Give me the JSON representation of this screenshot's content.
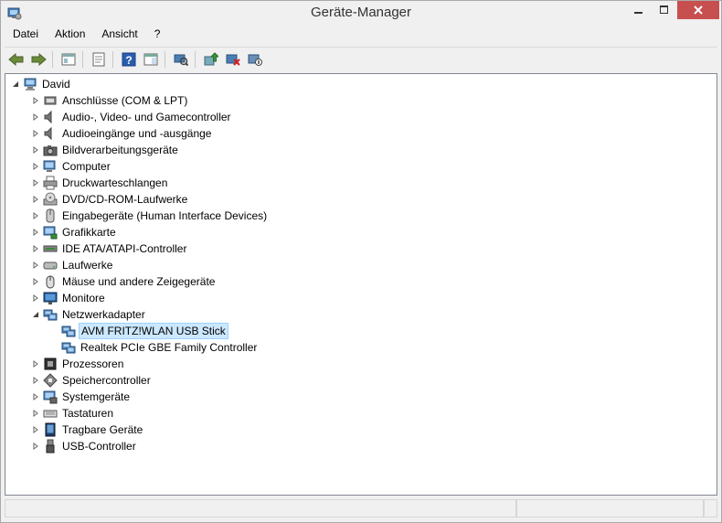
{
  "window": {
    "title": "Geräte-Manager"
  },
  "menu": {
    "items": [
      "Datei",
      "Aktion",
      "Ansicht",
      "?"
    ]
  },
  "tree": {
    "root": "David",
    "categories": [
      {
        "label": "Anschlüsse (COM & LPT)",
        "icon": "port-icon"
      },
      {
        "label": "Audio-, Video- und Gamecontroller",
        "icon": "speaker-icon"
      },
      {
        "label": "Audioeingänge und -ausgänge",
        "icon": "speaker-icon"
      },
      {
        "label": "Bildverarbeitungsgeräte",
        "icon": "camera-icon"
      },
      {
        "label": "Computer",
        "icon": "computer-icon"
      },
      {
        "label": "Druckwarteschlangen",
        "icon": "printer-icon"
      },
      {
        "label": "DVD/CD-ROM-Laufwerke",
        "icon": "disc-drive-icon"
      },
      {
        "label": "Eingabegeräte (Human Interface Devices)",
        "icon": "hid-icon"
      },
      {
        "label": "Grafikkarte",
        "icon": "display-adapter-icon"
      },
      {
        "label": "IDE ATA/ATAPI-Controller",
        "icon": "ide-controller-icon"
      },
      {
        "label": "Laufwerke",
        "icon": "disk-drive-icon"
      },
      {
        "label": "Mäuse und andere Zeigegeräte",
        "icon": "mouse-icon"
      },
      {
        "label": "Monitore",
        "icon": "monitor-icon"
      },
      {
        "label": "Netzwerkadapter",
        "icon": "network-adapter-icon",
        "expanded": true,
        "children": [
          {
            "label": "AVM FRITZ!WLAN USB Stick",
            "icon": "network-adapter-icon",
            "selected": true
          },
          {
            "label": "Realtek PCIe GBE Family Controller",
            "icon": "network-adapter-icon"
          }
        ]
      },
      {
        "label": "Prozessoren",
        "icon": "processor-icon"
      },
      {
        "label": "Speichercontroller",
        "icon": "storage-controller-icon"
      },
      {
        "label": "Systemgeräte",
        "icon": "system-device-icon"
      },
      {
        "label": "Tastaturen",
        "icon": "keyboard-icon"
      },
      {
        "label": "Tragbare Geräte",
        "icon": "portable-device-icon"
      },
      {
        "label": "USB-Controller",
        "icon": "usb-icon"
      }
    ]
  },
  "colors": {
    "selection_bg": "#cce8ff",
    "selection_border": "#99d1ff",
    "close_button": "#c74f4f"
  }
}
